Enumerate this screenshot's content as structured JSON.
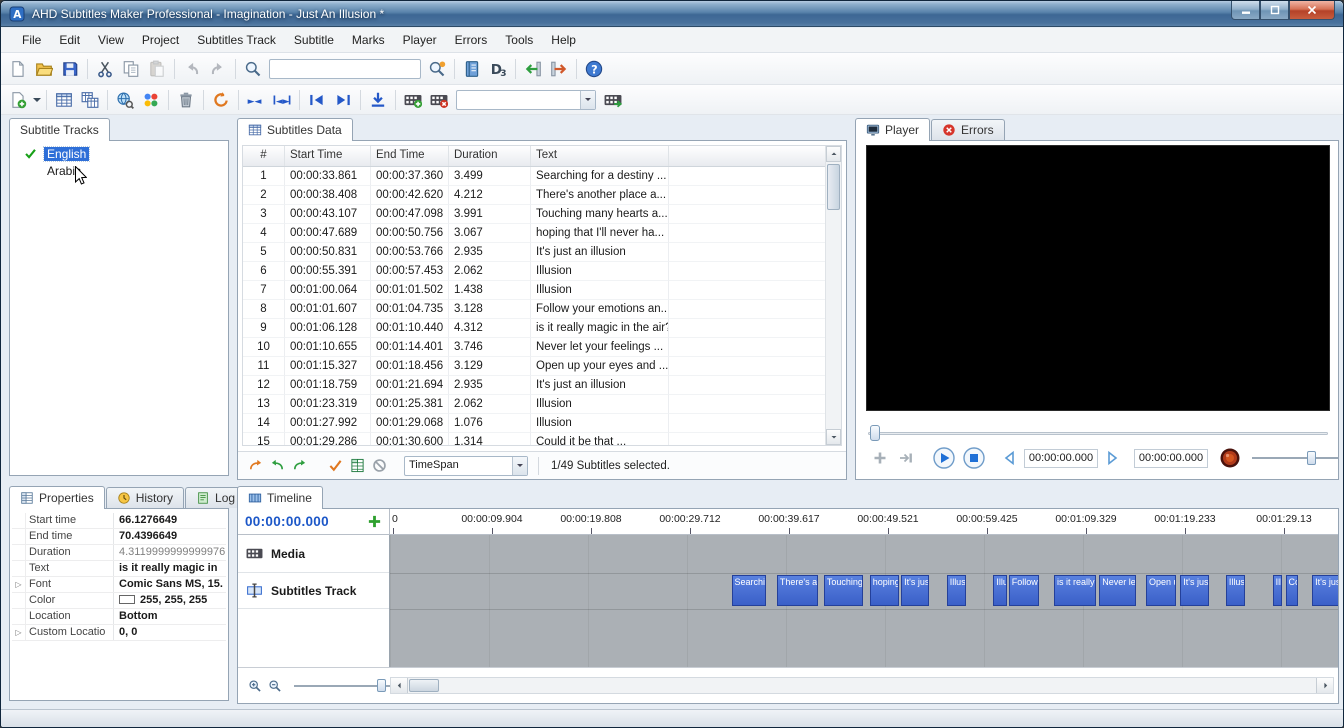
{
  "window": {
    "title": "AHD Subtitles Maker Professional - Imagination - Just An Illusion *"
  },
  "menu": {
    "items": [
      "File",
      "Edit",
      "View",
      "Project",
      "Subtitles Track",
      "Subtitle",
      "Marks",
      "Player",
      "Errors",
      "Tools",
      "Help"
    ]
  },
  "toolbar_main": {
    "search_value": "",
    "items": [
      {
        "icon": "new-file",
        "name": "new-project"
      },
      {
        "icon": "open-folder",
        "name": "open-project"
      },
      {
        "icon": "save",
        "name": "save-project"
      },
      {
        "sep": true
      },
      {
        "icon": "cut",
        "name": "cut"
      },
      {
        "icon": "copy",
        "name": "copy"
      },
      {
        "icon": "paste",
        "name": "paste",
        "disabled": true
      },
      {
        "sep": true
      },
      {
        "icon": "undo",
        "name": "undo",
        "disabled": true
      },
      {
        "icon": "redo",
        "name": "redo",
        "disabled": true
      },
      {
        "sep": true
      },
      {
        "icon": "zoom",
        "name": "find"
      },
      {
        "input": true,
        "name": "search-input"
      },
      {
        "icon": "search",
        "name": "search"
      },
      {
        "sep": true
      },
      {
        "icon": "notebook",
        "name": "project-notes"
      },
      {
        "icon": "d3",
        "name": "styles"
      },
      {
        "sep": true
      },
      {
        "icon": "import",
        "name": "import-subtitles"
      },
      {
        "icon": "export",
        "name": "export-subtitles"
      },
      {
        "sep": true
      },
      {
        "icon": "help",
        "name": "help"
      }
    ]
  },
  "toolbar_edit": {
    "items": [
      {
        "icon": "add-subtitle",
        "name": "add-subtitle",
        "caret": true
      },
      {
        "sep": true
      },
      {
        "icon": "grid",
        "name": "subtitles-grid"
      },
      {
        "icon": "grid-copy",
        "name": "copy-grid"
      },
      {
        "sep": true
      },
      {
        "icon": "web-search",
        "name": "web-search"
      },
      {
        "icon": "google",
        "name": "google-translate"
      },
      {
        "sep": true
      },
      {
        "icon": "trash",
        "name": "delete-subtitle"
      },
      {
        "sep": true
      },
      {
        "icon": "refresh",
        "name": "recalculate-times"
      },
      {
        "sep": true
      },
      {
        "icon": "join-arrows",
        "name": "join-subtitles"
      },
      {
        "icon": "extend-arrows",
        "name": "extend-subtitles"
      },
      {
        "sep": true
      },
      {
        "icon": "goto-start",
        "name": "goto-first-subtitle"
      },
      {
        "icon": "goto-end",
        "name": "goto-last-subtitle"
      },
      {
        "sep": true
      },
      {
        "icon": "insert-down",
        "name": "insert-subtitle-below"
      },
      {
        "sep": true
      },
      {
        "icon": "film-add",
        "name": "add-media"
      },
      {
        "icon": "film-remove",
        "name": "remove-media"
      },
      {
        "combo": true,
        "name": "media-select",
        "value": ""
      },
      {
        "icon": "film-extract",
        "name": "extract-media"
      }
    ]
  },
  "tracks_panel": {
    "tabs": [
      {
        "label": "Subtitle Tracks",
        "active": true
      }
    ],
    "items": [
      {
        "label": "English",
        "selected": true,
        "checked": true
      },
      {
        "label": "Arabic",
        "selected": false,
        "checked": false
      }
    ]
  },
  "subtitles_panel": {
    "tabs": [
      {
        "label": "Subtitles Data",
        "icon": "grid",
        "active": true
      }
    ],
    "columns": [
      "#",
      "Start Time",
      "End Time",
      "Duration",
      "Text"
    ],
    "rows": [
      [
        "1",
        "00:00:33.861",
        "00:00:37.360",
        "3.499",
        "Searching for a destiny ..."
      ],
      [
        "2",
        "00:00:38.408",
        "00:00:42.620",
        "4.212",
        "There's another place a..."
      ],
      [
        "3",
        "00:00:43.107",
        "00:00:47.098",
        "3.991",
        "Touching many hearts a..."
      ],
      [
        "4",
        "00:00:47.689",
        "00:00:50.756",
        "3.067",
        "hoping that I'll never ha..."
      ],
      [
        "5",
        "00:00:50.831",
        "00:00:53.766",
        "2.935",
        "It's just an illusion"
      ],
      [
        "6",
        "00:00:55.391",
        "00:00:57.453",
        "2.062",
        "Illusion"
      ],
      [
        "7",
        "00:01:00.064",
        "00:01:01.502",
        "1.438",
        "Illusion"
      ],
      [
        "8",
        "00:01:01.607",
        "00:01:04.735",
        "3.128",
        "Follow your emotions an..."
      ],
      [
        "9",
        "00:01:06.128",
        "00:01:10.440",
        "4.312",
        "is it really magic in the air?"
      ],
      [
        "10",
        "00:01:10.655",
        "00:01:14.401",
        "3.746",
        "Never let your feelings ..."
      ],
      [
        "11",
        "00:01:15.327",
        "00:01:18.456",
        "3.129",
        "Open up your eyes and ..."
      ],
      [
        "12",
        "00:01:18.759",
        "00:01:21.694",
        "2.935",
        "It's just an illusion"
      ],
      [
        "13",
        "00:01:23.319",
        "00:01:25.381",
        "2.062",
        "Illusion"
      ],
      [
        "14",
        "00:01:27.992",
        "00:01:29.068",
        "1.076",
        "Illusion"
      ],
      [
        "15",
        "00:01:29.286",
        "00:01:30.600",
        "1.314",
        "Could it be that ..."
      ]
    ],
    "footer": {
      "icons": [
        {
          "icon": "jump",
          "name": "goto-current-subtitle"
        },
        {
          "icon": "undo-green",
          "name": "undo-edit"
        },
        {
          "icon": "redo-green",
          "name": "redo-edit"
        },
        {
          "icon": "validate",
          "name": "validate-subtitles"
        },
        {
          "icon": "excel",
          "name": "export-table"
        },
        {
          "icon": "disable",
          "name": "disable-subtitle"
        }
      ],
      "combo_value": "TimeSpan",
      "status": "1/49 Subtitles selected."
    }
  },
  "player_panel": {
    "tabs": [
      {
        "label": "Player",
        "icon": "player-tab",
        "active": true
      },
      {
        "label": "Errors",
        "icon": "errors-tab",
        "active": false
      }
    ],
    "current_time": "00:00:00.000",
    "total_time": "00:00:00.000",
    "controls": [
      {
        "icon": "plus",
        "name": "add-marker",
        "disabled": true
      },
      {
        "icon": "step-end",
        "name": "step-to-end",
        "disabled": true
      },
      {
        "icon": "play",
        "name": "play",
        "big": true
      },
      {
        "icon": "stop",
        "name": "stop",
        "big": true
      },
      {
        "icon": "prev",
        "name": "previous-subtitle"
      },
      {
        "time": "current_time",
        "name": "current-time"
      },
      {
        "icon": "next",
        "name": "next-subtitle"
      },
      {
        "time": "total_time",
        "name": "media-duration"
      },
      {
        "icon": "record",
        "name": "record",
        "big": true
      },
      {
        "slider": true,
        "name": "volume-slider"
      }
    ]
  },
  "properties_panel": {
    "tabs": [
      {
        "label": "Properties",
        "icon": "properties-tab",
        "active": true
      },
      {
        "label": "History",
        "icon": "history-tab",
        "active": false
      },
      {
        "label": "Log",
        "icon": "log-tab",
        "active": false
      }
    ],
    "rows": [
      {
        "label": "Start time",
        "value": "66.1276649",
        "bold": true
      },
      {
        "label": "End time",
        "value": "70.4396649",
        "bold": true
      },
      {
        "label": "Duration",
        "value": "4.3119999999999976",
        "muted": true
      },
      {
        "label": "Text",
        "value": "is it really magic in",
        "bold": true
      },
      {
        "label": "Font",
        "value": "Comic Sans MS, 15.",
        "bold": true,
        "expander": true
      },
      {
        "label": "Color",
        "value": "255, 255, 255",
        "bold": true,
        "swatch": "#ffffff"
      },
      {
        "label": "Location",
        "value": "Bottom",
        "bold": true
      },
      {
        "label": "Custom Locatio",
        "value": "0, 0",
        "bold": true,
        "expander": true
      }
    ]
  },
  "timeline_panel": {
    "tabs": [
      {
        "label": "Timeline",
        "icon": "timeline-tab",
        "active": true
      }
    ],
    "cursor_time": "00:00:00.000",
    "ruler": [
      "0",
      "00:00:09.904",
      "00:00:19.808",
      "00:00:29.712",
      "00:00:39.617",
      "00:00:49.521",
      "00:00:59.425",
      "00:01:09.329",
      "00:01:19.233",
      "00:01:29.13"
    ],
    "tracks": [
      {
        "icon": "media",
        "label": "Media"
      },
      {
        "icon": "subtitles-track",
        "label": "Subtitles Track"
      }
    ],
    "extra_blocks": [
      {
        "text": "It's just an illusion",
        "start": 91.95,
        "dur": 2.935
      }
    ]
  }
}
